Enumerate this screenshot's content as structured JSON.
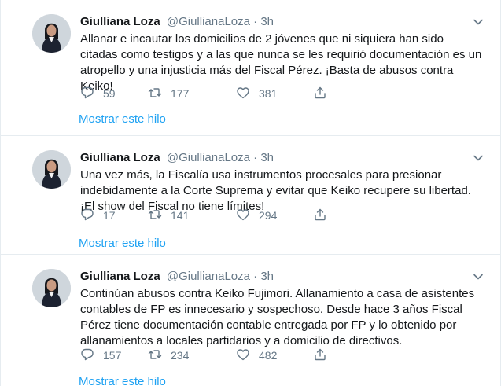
{
  "tweets": [
    {
      "name": "Giulliana Loza",
      "handle": "@GiullianaLoza",
      "dot": "·",
      "time": "3h",
      "text": "Allanar e incautar los domicilios de 2 jóvenes que ni siquiera han sido citadas como testigos y a las que nunca se les requirió documentación es un atropello y una injusticia más del Fiscal Pérez. ¡Basta de abusos contra Keiko!",
      "replies": "59",
      "retweets": "177",
      "likes": "381",
      "thread_link": "Mostrar este hilo"
    },
    {
      "name": "Giulliana Loza",
      "handle": "@GiullianaLoza",
      "dot": "·",
      "time": "3h",
      "text": "Una vez más, la Fiscalía usa instrumentos procesales para presionar indebidamente a la Corte Suprema y evitar que Keiko recupere su libertad. ¡El show del Fiscal no tiene límites!",
      "replies": "17",
      "retweets": "141",
      "likes": "294",
      "thread_link": "Mostrar este hilo"
    },
    {
      "name": "Giulliana Loza",
      "handle": "@GiullianaLoza",
      "dot": "·",
      "time": "3h",
      "text": "Continúan abusos contra Keiko Fujimori. Allanamiento a casa de asistentes contables de FP es innecesario y sospechoso. Desde hace 3 años Fiscal Pérez tiene documentación contable entregada por FP y lo obtenido por allanamientos a locales partidarios y a domicilio de directivos.",
      "replies": "157",
      "retweets": "234",
      "likes": "482",
      "thread_link": "Mostrar este hilo"
    }
  ],
  "colors": {
    "accent": "#1da1f2",
    "secondary_text": "#657786",
    "primary_text": "#14171a",
    "divider": "#e6ecf0"
  },
  "icons": [
    "reply-icon",
    "retweet-icon",
    "like-icon",
    "share-icon",
    "caret-down-icon"
  ]
}
